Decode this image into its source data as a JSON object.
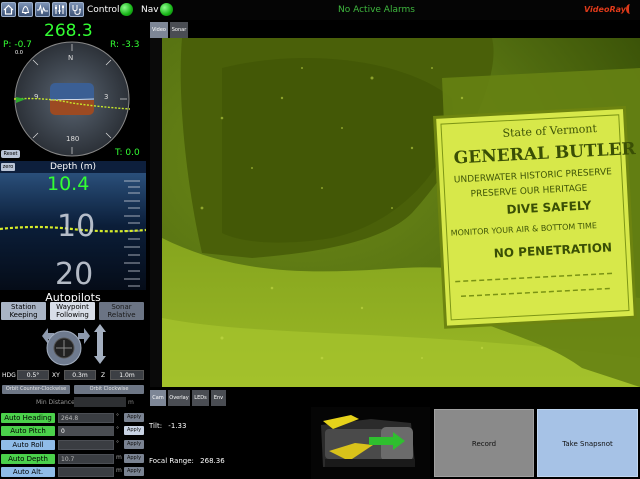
{
  "topbar": {
    "icons": [
      "bell-icon",
      "waveform-icon",
      "sliders-icon",
      "stethoscope-icon",
      "home-icon"
    ],
    "control_label": "Control",
    "nav_label": "Nav",
    "alarms_text": "No Active Alarms",
    "logo_text": "VideoRay",
    "led_color": "#17b417",
    "alarm_color": "#3fb83f",
    "brand_color": "#e03a1a"
  },
  "heading": {
    "value": "268.3",
    "pitch_label": "P: -0.7",
    "pitch_zero": "0.0",
    "roll_label": "R: -3.3",
    "tilt_label": "T: 0.0",
    "reset_label": "Reset",
    "compass_marks": [
      "N",
      "3",
      "9",
      "180"
    ]
  },
  "depth": {
    "title": "Depth (m)",
    "zero_label": "zero",
    "current": "10.4",
    "ticks": [
      "10",
      "20"
    ]
  },
  "autopilots": {
    "title": "Autopilots",
    "modes": [
      {
        "label_line1": "Station",
        "label_line2": "Keeping"
      },
      {
        "label_line1": "Waypoint",
        "label_line2": "Following"
      },
      {
        "label_line1": "Sonar",
        "label_line2": "Relative"
      }
    ],
    "hdg_label": "HDG",
    "hdg_value": "0.5°",
    "xy_label": "XY",
    "xy_value": "0.3m",
    "z_label": "Z",
    "z_value": "1.0m",
    "orbit_ccw": "Orbit Counter-Clockwise",
    "orbit_cw": "Orbit Clockwise",
    "min_distance_label": "Min Distance",
    "min_distance_unit": "m",
    "rows": [
      {
        "label": "Auto Heading",
        "value": "264.8",
        "unit": "°",
        "apply": "Apply",
        "on": true
      },
      {
        "label": "Auto Pitch",
        "value": "0",
        "unit": "°",
        "apply": "Apply",
        "on": true
      },
      {
        "label": "Auto Roll",
        "value": "",
        "unit": "°",
        "apply": "Apply",
        "on": false
      },
      {
        "label": "Auto Depth",
        "value": "10.7",
        "unit": "m",
        "apply": "Apply",
        "on": true
      },
      {
        "label": "Auto Alt.",
        "value": "",
        "unit": "m",
        "apply": "Apply",
        "on": false
      }
    ]
  },
  "video": {
    "tabs": [
      "Video",
      "Sonar"
    ],
    "sign_lines": [
      "State of Vermont",
      "GENERAL BUTLER",
      "UNDERWATER HISTORIC PRESERVE",
      "PRESERVE OUR HERITAGE",
      "DIVE SAFELY",
      "MONITOR YOUR AIR & BOTTOM TIME",
      "NO PENETRATION"
    ]
  },
  "bottom": {
    "tabs": [
      "Cam",
      "Overlay",
      "LEDs",
      "Env"
    ],
    "tilt_label": "Tilt:",
    "tilt_value": "-1.33",
    "focal_label": "Focal Range:",
    "focal_value": "268.36",
    "record_label": "Record",
    "snapshot_label": "Take Snapsnot"
  }
}
